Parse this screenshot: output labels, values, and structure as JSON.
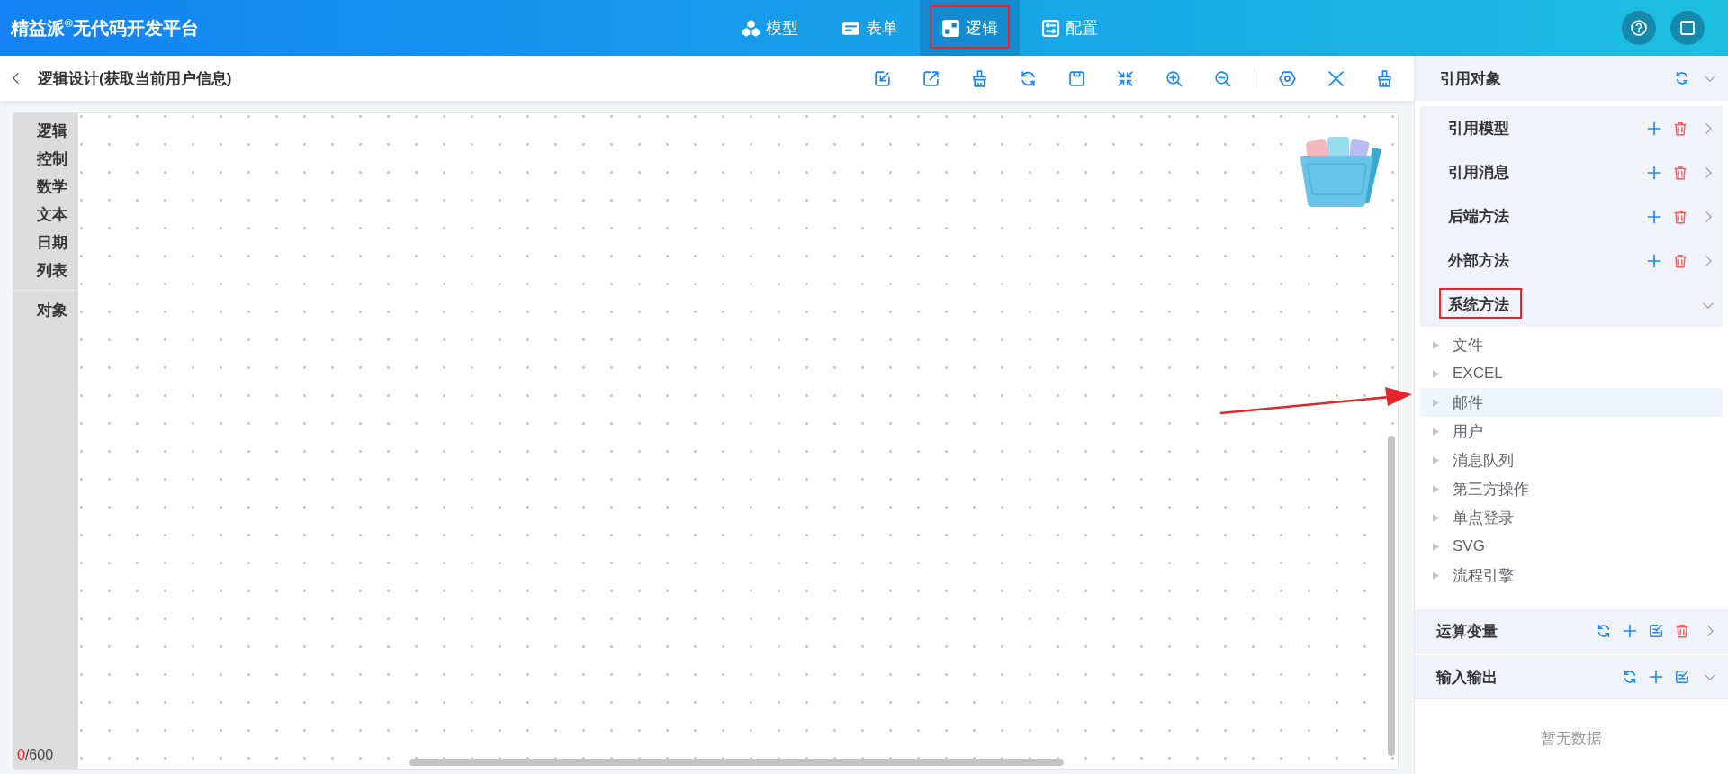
{
  "app": {
    "title": "精益派$^{®}$无代码开发平台"
  },
  "nav_tabs": [
    {
      "label": "模型",
      "kind": "model",
      "selected": false,
      "highlighted": false
    },
    {
      "label": "表单",
      "kind": "form",
      "selected": false,
      "highlighted": false
    },
    {
      "label": "逻辑",
      "kind": "logic",
      "selected": true,
      "highlighted": true
    },
    {
      "label": "配置",
      "kind": "config",
      "selected": false,
      "highlighted": false
    }
  ],
  "header_buttons": [
    {
      "kind": "help"
    },
    {
      "kind": "fullscreen"
    }
  ],
  "editor": {
    "title": "逻辑设计(获取当前用户信息)",
    "tools": [
      {
        "kind": "import"
      },
      {
        "kind": "export"
      },
      {
        "kind": "brush"
      },
      {
        "kind": "refresh"
      },
      {
        "kind": "save"
      },
      {
        "kind": "collapse"
      },
      {
        "kind": "zoom-in"
      },
      {
        "kind": "zoom-out"
      },
      {
        "kind": "separator"
      },
      {
        "kind": "hexagon"
      },
      {
        "kind": "close"
      },
      {
        "kind": "brush"
      }
    ]
  },
  "palette": {
    "groups": [
      {
        "items": [
          "逻辑",
          "控制",
          "数学",
          "文本",
          "日期",
          "列表"
        ]
      },
      {
        "items": [
          "对象"
        ]
      }
    ]
  },
  "canvas": {
    "count": "0",
    "limit": "/600"
  },
  "references": {
    "title": "引用对象",
    "expanded": true,
    "actions": [
      {
        "kind": "refresh"
      }
    ],
    "groups": [
      {
        "label": "引用模型",
        "expanded": false,
        "highlighted": false,
        "actions": [
          {
            "kind": "add"
          },
          {
            "kind": "delete"
          }
        ]
      },
      {
        "label": "引用消息",
        "expanded": false,
        "highlighted": false,
        "actions": [
          {
            "kind": "add"
          },
          {
            "kind": "delete"
          }
        ]
      },
      {
        "label": "后端方法",
        "expanded": false,
        "highlighted": false,
        "actions": [
          {
            "kind": "add"
          },
          {
            "kind": "delete"
          }
        ]
      },
      {
        "label": "外部方法",
        "expanded": false,
        "highlighted": false,
        "actions": [
          {
            "kind": "add"
          },
          {
            "kind": "delete"
          }
        ]
      },
      {
        "label": "系统方法",
        "expanded": true,
        "highlighted": true,
        "children": [
          {
            "label": "文件",
            "selected": false,
            "pointed": false
          },
          {
            "label": "EXCEL",
            "selected": false,
            "pointed": false
          },
          {
            "label": "邮件",
            "selected": true,
            "pointed": true
          },
          {
            "label": "用户",
            "selected": false,
            "pointed": false
          },
          {
            "label": "消息队列",
            "selected": false,
            "pointed": false
          },
          {
            "label": "第三方操作",
            "selected": false,
            "pointed": false
          },
          {
            "label": "单点登录",
            "selected": false,
            "pointed": false
          },
          {
            "label": "SVG",
            "selected": false,
            "pointed": false
          },
          {
            "label": "流程引擎",
            "selected": false,
            "pointed": false
          }
        ]
      }
    ]
  },
  "sections": [
    {
      "title": "运算变量",
      "expanded": false,
      "actions": [
        {
          "kind": "refresh"
        },
        {
          "kind": "add"
        },
        {
          "kind": "edit"
        },
        {
          "kind": "delete"
        }
      ]
    },
    {
      "title": "输入输出",
      "expanded": true,
      "actions": [
        {
          "kind": "refresh"
        },
        {
          "kind": "add"
        },
        {
          "kind": "edit"
        }
      ],
      "empty_text": "暂无数据"
    }
  ]
}
